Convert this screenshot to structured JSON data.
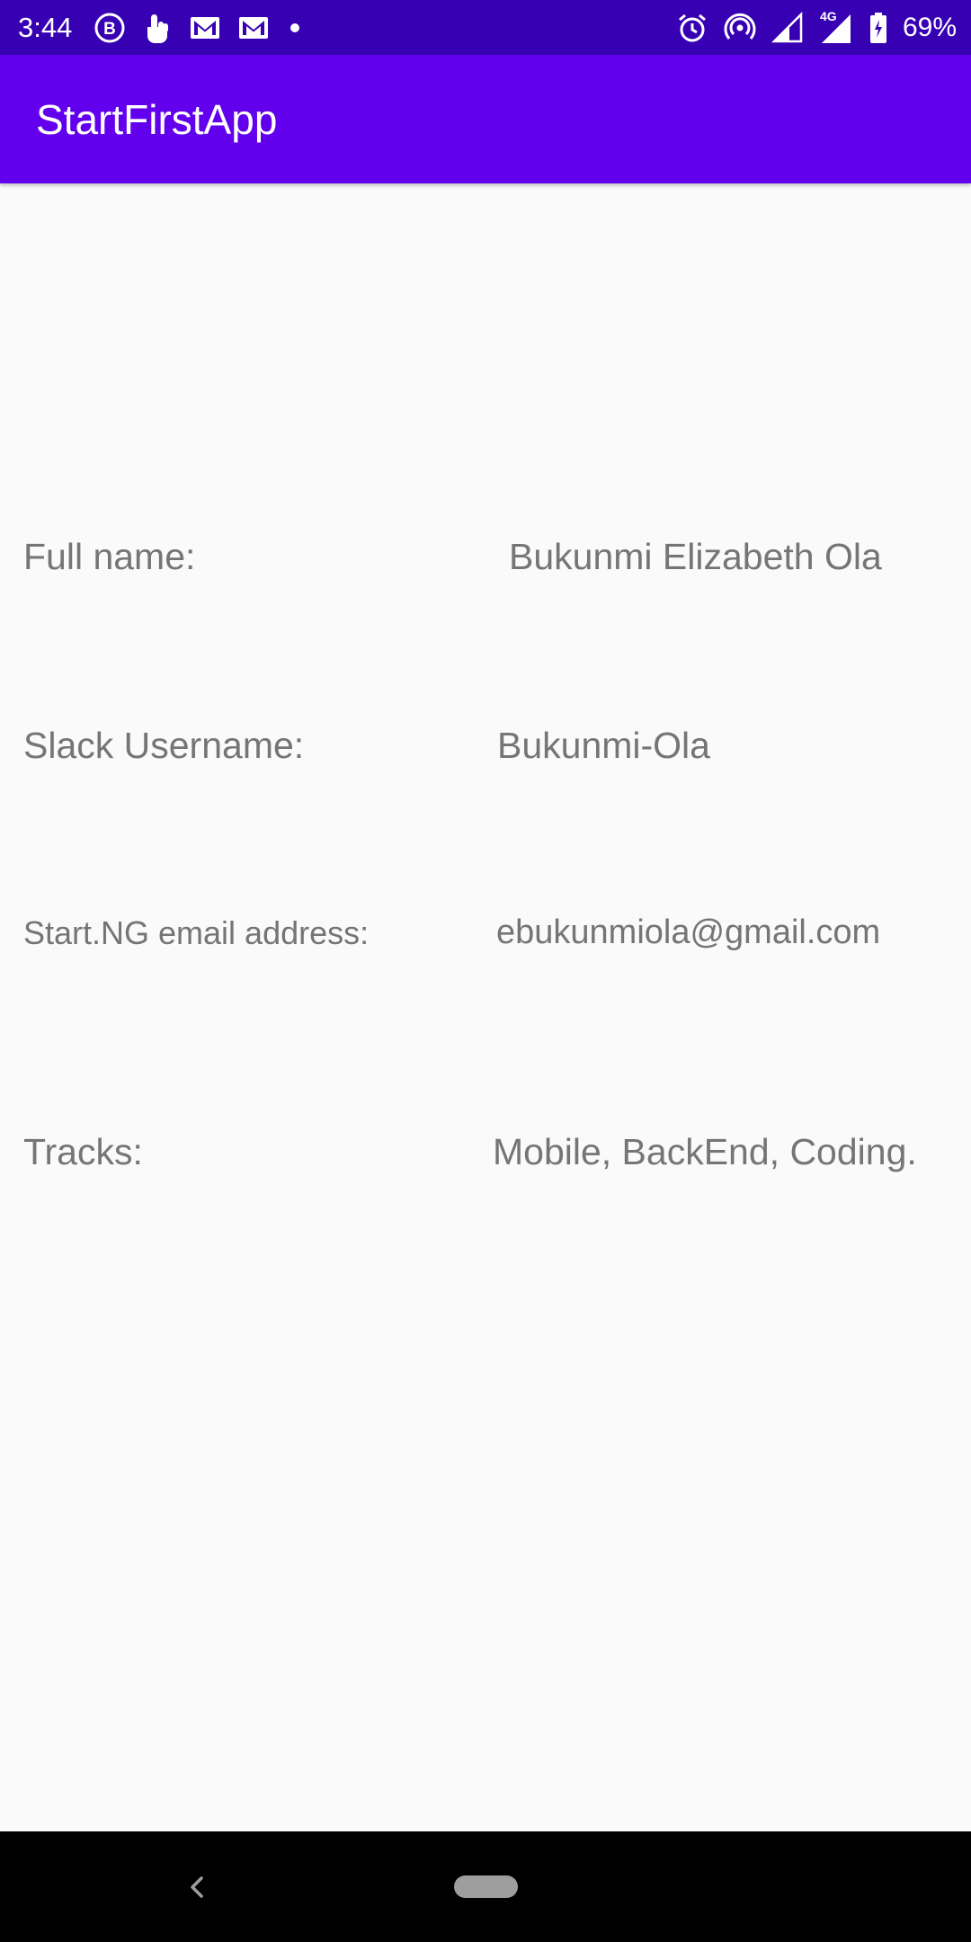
{
  "status_bar": {
    "time": "3:44",
    "battery": "69%",
    "left_icons": [
      "b-circle-icon",
      "touch-icon",
      "gmail-icon",
      "gmail-icon",
      "dot-icon"
    ],
    "right_icons": [
      "alarm-icon",
      "hotspot-icon",
      "signal-icon",
      "signal-4g-icon",
      "battery-icon"
    ],
    "network_label": "4G"
  },
  "app_bar": {
    "title": "StartFirstApp"
  },
  "profile": {
    "rows": [
      {
        "label": "Full name:",
        "value": "Bukunmi Elizabeth Ola"
      },
      {
        "label": "Slack Username:",
        "value": "Bukunmi-Ola"
      },
      {
        "label": "Start.NG email address:",
        "value": "ebukunmiola@gmail.com"
      },
      {
        "label": "Tracks:",
        "value": "Mobile, BackEnd, Coding."
      }
    ]
  },
  "colors": {
    "status_bar": "#3700B3",
    "app_bar": "#6200EE",
    "background": "#FAFAFA",
    "text": "#757575",
    "nav_bar": "#000000"
  }
}
